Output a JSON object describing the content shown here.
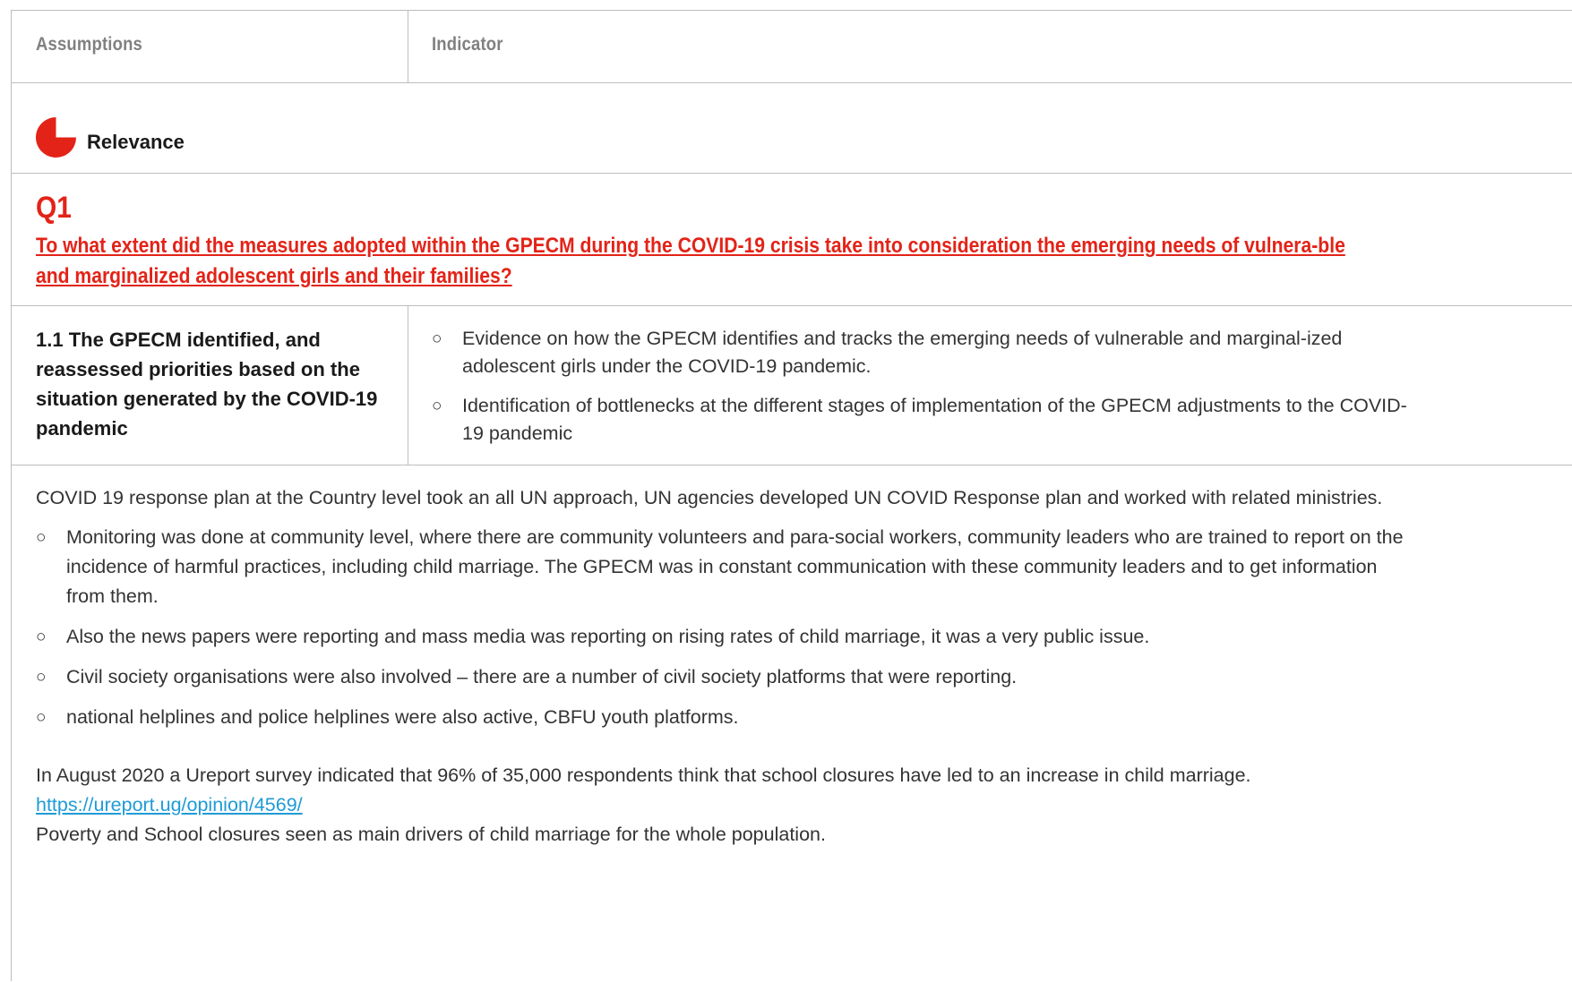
{
  "table_header": {
    "col1": "Assumptions",
    "col2": "Indicator"
  },
  "section": {
    "icon": "pie-chart-quarter-icon",
    "label": "Relevance",
    "accent_color": "#e32318"
  },
  "question": {
    "number": "Q1",
    "text": "To what extent did the measures adopted within the GPECM during the COVID-19 crisis take into consideration the emerging needs of vulnera-ble and marginalized adolescent girls and their families?"
  },
  "assumption": {
    "text": "1.1 The GPECM identified, and reassessed priorities based on the situation generated by the COVID-19 pandemic",
    "indicators": [
      "Evidence on how the GPECM identifies and tracks the emerging needs of vulnerable and marginal-ized adolescent girls under the COVID-19 pandemic.",
      "Identification of bottlenecks at the different stages of implementation of the GPECM adjustments to the COVID-19 pandemic"
    ]
  },
  "findings": {
    "intro": "COVID 19 response plan at the Country level took an all UN approach, UN agencies developed UN COVID Response plan and worked with related ministries.",
    "bullets": [
      "Monitoring was done at community level, where there are community volunteers and para-social workers, community leaders who are trained to report on the incidence of harmful practices, including child marriage. The GPECM was in constant communication with these community leaders and to get information from them.",
      "Also the news papers were reporting and mass media was reporting on rising rates of child marriage, it was a very public issue.",
      "Civil society organisations were also involved – there are a number of civil society platforms that were reporting.",
      "national helplines and police helplines were also active, CBFU youth platforms."
    ],
    "survey": "In August 2020 a Ureport survey indicated that 96% of 35,000 respondents think that school closures have led to an increase in child marriage.",
    "link": "https://ureport.ug/opinion/4569/",
    "closing": "Poverty and School closures seen as main drivers of child marriage for the whole population."
  },
  "bullet_symbol": "○"
}
